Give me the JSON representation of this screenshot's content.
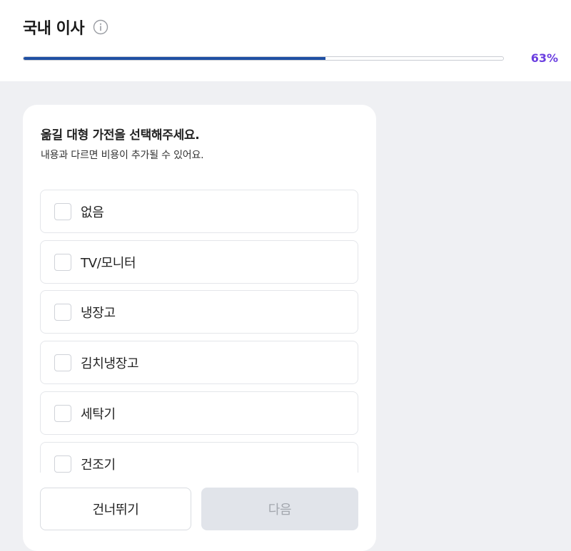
{
  "header": {
    "title": "국내 이사",
    "info_icon": "info-icon",
    "progress_percent": 63,
    "progress_label": "63%",
    "colors": {
      "progress_fill": "#1f4fa3",
      "percent_text": "#6b3fe0"
    }
  },
  "card": {
    "question": "옮길 대형 가전을 선택해주세요.",
    "subtext": "내용과 다르면 비용이 추가될 수 있어요.",
    "options": [
      {
        "label": "없음",
        "checked": false
      },
      {
        "label": "TV/모니터",
        "checked": false
      },
      {
        "label": "냉장고",
        "checked": false
      },
      {
        "label": "김치냉장고",
        "checked": false
      },
      {
        "label": "세탁기",
        "checked": false
      },
      {
        "label": "건조기",
        "checked": false
      }
    ],
    "buttons": {
      "skip": "건너뛰기",
      "next": "다음"
    }
  }
}
